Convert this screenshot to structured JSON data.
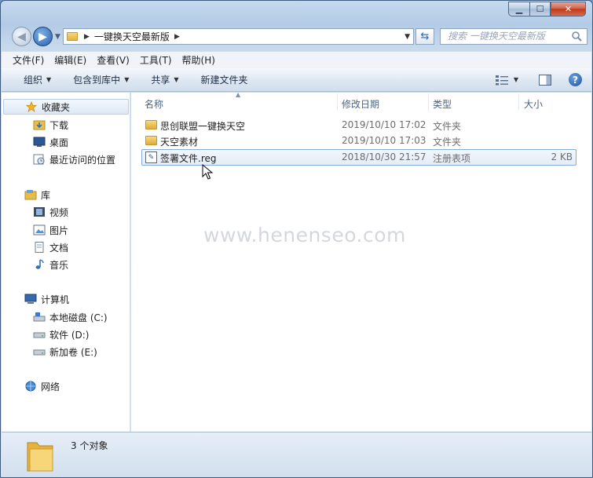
{
  "window": {
    "caption": {
      "minimize": "▁",
      "maximize": "☐",
      "close": "✕"
    }
  },
  "address": {
    "path": "一键换天空最新版",
    "search_placeholder": "搜索 一键换天空最新版"
  },
  "menu": [
    "文件(F)",
    "编辑(E)",
    "查看(V)",
    "工具(T)",
    "帮助(H)"
  ],
  "toolbar": {
    "organize": "组织",
    "include_library": "包含到库中",
    "share": "共享",
    "new_folder": "新建文件夹"
  },
  "nav": {
    "favorites": "收藏夹",
    "favorites_items": [
      "下载",
      "桌面",
      "最近访问的位置"
    ],
    "libraries": "库",
    "library_items": [
      "视频",
      "图片",
      "文档",
      "音乐"
    ],
    "computer": "计算机",
    "drives": [
      "本地磁盘 (C:)",
      "软件 (D:)",
      "新加卷 (E:)"
    ],
    "network": "网络"
  },
  "columns": {
    "name": "名称",
    "modified": "修改日期",
    "type": "类型",
    "size": "大小"
  },
  "files": [
    {
      "name": "思创联盟一键换天空",
      "modified": "2019/10/10 17:02",
      "type": "文件夹",
      "size": "",
      "icon": "folder-icon"
    },
    {
      "name": "天空素材",
      "modified": "2019/10/10 17:03",
      "type": "文件夹",
      "size": "",
      "icon": "folder-icon"
    },
    {
      "name": "签署文件.reg",
      "modified": "2018/10/30 21:57",
      "type": "注册表项",
      "size": "2 KB",
      "icon": "registry-file-icon"
    }
  ],
  "watermark": "www.henenseo.com",
  "details": {
    "count": "3 个对象"
  }
}
